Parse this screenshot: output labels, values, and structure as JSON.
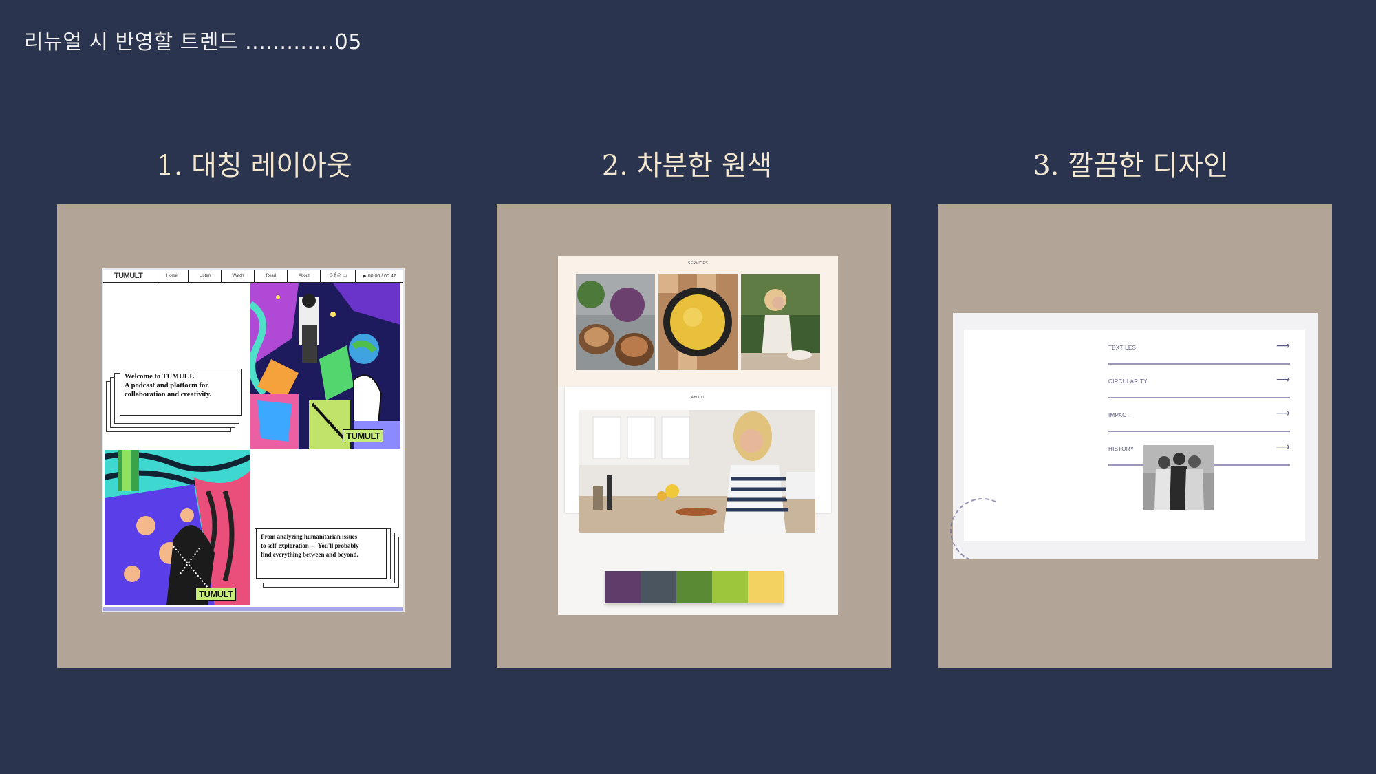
{
  "header": "리뉴얼 시 반영할 트렌드  .............05",
  "columns": [
    {
      "title": "1. 대칭 레이아웃"
    },
    {
      "title": "2. 차분한 원색"
    },
    {
      "title": "3. 깔끔한 디자인"
    }
  ],
  "tumult": {
    "logo": "TUMULT",
    "nav": [
      "Home",
      "Listen",
      "Watch",
      "Read",
      "About"
    ],
    "icons": "⊙ f ◎ ▭",
    "player": "▶ 00:00 / 00:47",
    "welcome": [
      "Welcome to TUMULT.",
      "A podcast and platform for",
      "collaboration and creativity."
    ],
    "about": [
      "From analyzing humanitarian issues",
      "to self-exploration — You'll probably",
      "find everything between and beyond."
    ],
    "tag": "TUMULT"
  },
  "card2": {
    "services_label": "SERVICES",
    "about_label": "ABOUT",
    "palette": [
      "#5e3d6b",
      "#4a5560",
      "#5a8a34",
      "#9dc63c",
      "#f3d261"
    ]
  },
  "card3": {
    "menu": [
      {
        "label": "TEXTILES",
        "arrow": "⟶"
      },
      {
        "label": "CIRCULARITY",
        "arrow": "⟶"
      },
      {
        "label": "IMPACT",
        "arrow": "⟶"
      },
      {
        "label": "HISTORY",
        "arrow": "⟶"
      }
    ]
  }
}
